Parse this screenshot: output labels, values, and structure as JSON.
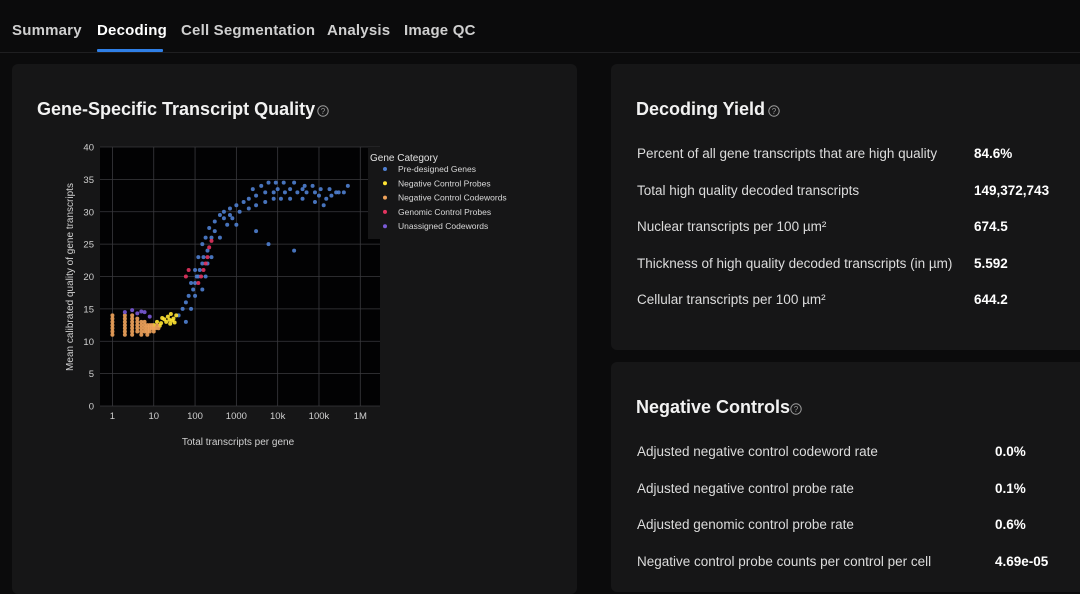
{
  "tabs": [
    {
      "label": "Summary",
      "active": false
    },
    {
      "label": "Decoding",
      "active": true
    },
    {
      "label": "Cell Segmentation",
      "active": false
    },
    {
      "label": "Analysis",
      "active": false
    },
    {
      "label": "Image QC",
      "active": false
    }
  ],
  "accent_color": "#2f7fe6",
  "help_icon": "question-circle-icon",
  "transcript_quality": {
    "title": "Gene-Specific Transcript Quality"
  },
  "decoding_yield": {
    "title": "Decoding Yield",
    "rows": [
      {
        "label": "Percent of all gene transcripts that are high quality",
        "value": "84.6%"
      },
      {
        "label": "Total high quality decoded transcripts",
        "value": "149,372,743"
      },
      {
        "label": "Nuclear transcripts per 100 µm²",
        "value": "674.5"
      },
      {
        "label": "Thickness of high quality decoded transcripts (in µm)",
        "value": "5.592"
      },
      {
        "label": "Cellular transcripts per 100 µm²",
        "value": "644.2"
      }
    ]
  },
  "negative_controls": {
    "title": "Negative Controls",
    "rows": [
      {
        "label": "Adjusted negative control codeword rate",
        "value": "0.0%"
      },
      {
        "label": "Adjusted negative control probe rate",
        "value": "0.1%"
      },
      {
        "label": "Adjusted genomic control probe rate",
        "value": "0.6%"
      },
      {
        "label": "Negative control probe counts per control per cell",
        "value": "4.69e-05"
      }
    ]
  },
  "chart_data": {
    "type": "scatter",
    "title": "",
    "xlabel": "Total transcripts per gene",
    "ylabel": "Mean calibrated quality of gene transcripts",
    "x_scale": "log",
    "xlim": [
      0.5,
      3000000
    ],
    "ylim": [
      0,
      40
    ],
    "x_ticks": [
      {
        "value": 1,
        "label": "1"
      },
      {
        "value": 10,
        "label": "10"
      },
      {
        "value": 100,
        "label": "100"
      },
      {
        "value": 1000,
        "label": "1000"
      },
      {
        "value": 10000,
        "label": "10k"
      },
      {
        "value": 100000,
        "label": "100k"
      },
      {
        "value": 1000000,
        "label": "1M"
      }
    ],
    "y_ticks": [
      0,
      5,
      10,
      15,
      20,
      25,
      30,
      35,
      40
    ],
    "grid": true,
    "legend_position": "top-right",
    "legend_title": "Gene Category",
    "series": [
      {
        "name": "Pre-designed Genes",
        "color": "#4f7fd0",
        "points": [
          [
            40,
            14
          ],
          [
            50,
            15
          ],
          [
            60,
            16
          ],
          [
            70,
            17
          ],
          [
            80,
            19
          ],
          [
            100,
            21
          ],
          [
            120,
            23
          ],
          [
            150,
            25
          ],
          [
            180,
            26
          ],
          [
            220,
            27.5
          ],
          [
            300,
            28.5
          ],
          [
            400,
            29.5
          ],
          [
            500,
            30
          ],
          [
            700,
            30.5
          ],
          [
            1000,
            31
          ],
          [
            1500,
            31.5
          ],
          [
            2000,
            32
          ],
          [
            3000,
            32.5
          ],
          [
            5000,
            33
          ],
          [
            8000,
            33
          ],
          [
            10000,
            33.5
          ],
          [
            15000,
            33
          ],
          [
            20000,
            33.5
          ],
          [
            30000,
            33
          ],
          [
            40000,
            33.5
          ],
          [
            50000,
            33
          ],
          [
            80000,
            33
          ],
          [
            100000,
            32.5
          ],
          [
            150000,
            32
          ],
          [
            200000,
            32.5
          ],
          [
            300000,
            33
          ],
          [
            500000,
            34
          ],
          [
            120,
            20
          ],
          [
            150,
            22
          ],
          [
            200,
            24
          ],
          [
            250,
            26
          ],
          [
            300,
            27
          ],
          [
            150,
            18
          ],
          [
            180,
            20
          ],
          [
            250,
            23
          ],
          [
            400,
            26
          ],
          [
            600,
            28
          ],
          [
            800,
            29
          ],
          [
            1200,
            30
          ],
          [
            2000,
            30.5
          ],
          [
            3000,
            31
          ],
          [
            5000,
            31.5
          ],
          [
            8000,
            32
          ],
          [
            12000,
            32
          ],
          [
            20000,
            32
          ],
          [
            40000,
            32
          ],
          [
            80000,
            31.5
          ],
          [
            130000,
            31
          ],
          [
            60,
            13
          ],
          [
            80,
            15
          ],
          [
            100,
            17
          ],
          [
            200,
            22
          ],
          [
            1000,
            28
          ],
          [
            3000,
            27
          ],
          [
            6000,
            25
          ],
          [
            25000,
            24
          ],
          [
            100,
            19
          ],
          [
            90,
            18
          ],
          [
            110,
            20
          ],
          [
            130,
            21
          ],
          [
            160,
            23
          ],
          [
            700,
            29.5
          ],
          [
            500,
            29
          ],
          [
            2500,
            33.5
          ],
          [
            4000,
            34
          ],
          [
            6000,
            34.5
          ],
          [
            9000,
            34.5
          ],
          [
            14000,
            34.5
          ],
          [
            25000,
            34.5
          ],
          [
            45000,
            34
          ],
          [
            70000,
            34
          ],
          [
            110000,
            33.5
          ],
          [
            180000,
            33.5
          ],
          [
            260000,
            33
          ],
          [
            400000,
            33
          ],
          [
            2000000,
            34
          ]
        ]
      },
      {
        "name": "Negative Control Probes",
        "color": "#ffe433",
        "points": [
          [
            10,
            12.5
          ],
          [
            12,
            13
          ],
          [
            15,
            12.8
          ],
          [
            18,
            13.4
          ],
          [
            20,
            13
          ],
          [
            22,
            13.8
          ],
          [
            25,
            12.7
          ],
          [
            28,
            13.2
          ],
          [
            30,
            13.5
          ],
          [
            32,
            12.9
          ],
          [
            35,
            14
          ],
          [
            16,
            13.6
          ],
          [
            24,
            13.3
          ],
          [
            26,
            14.2
          ],
          [
            14,
            12.4
          ]
        ]
      },
      {
        "name": "Negative Control Codewords",
        "color": "#f0a35b",
        "points": [
          [
            1,
            11
          ],
          [
            1,
            11.5
          ],
          [
            1,
            12
          ],
          [
            1,
            12.5
          ],
          [
            1,
            13
          ],
          [
            1,
            13.5
          ],
          [
            1,
            14
          ],
          [
            2,
            11
          ],
          [
            2,
            11.5
          ],
          [
            2,
            12
          ],
          [
            2,
            12.5
          ],
          [
            2,
            13
          ],
          [
            2,
            13.5
          ],
          [
            2,
            14
          ],
          [
            3,
            11
          ],
          [
            3,
            11.5
          ],
          [
            3,
            12
          ],
          [
            3,
            12.5
          ],
          [
            3,
            13
          ],
          [
            3,
            13.5
          ],
          [
            3,
            14
          ],
          [
            4,
            11.5
          ],
          [
            4,
            12
          ],
          [
            4,
            12.5
          ],
          [
            4,
            13
          ],
          [
            4,
            13.5
          ],
          [
            5,
            11
          ],
          [
            5,
            11.5
          ],
          [
            5,
            12
          ],
          [
            5,
            12.5
          ],
          [
            5,
            13
          ],
          [
            6,
            11.5
          ],
          [
            6,
            12
          ],
          [
            6,
            12.5
          ],
          [
            6,
            13
          ],
          [
            7,
            11
          ],
          [
            7,
            11.5
          ],
          [
            7,
            12
          ],
          [
            7,
            12.5
          ],
          [
            8,
            11.5
          ],
          [
            8,
            12
          ],
          [
            8,
            12.5
          ],
          [
            9,
            12
          ],
          [
            9,
            12.5
          ],
          [
            10,
            11.5
          ],
          [
            10,
            12
          ],
          [
            11,
            12
          ],
          [
            12,
            12.5
          ],
          [
            13,
            12
          ]
        ]
      },
      {
        "name": "Genomic Control Probes",
        "color": "#e3345f",
        "points": [
          [
            120,
            19
          ],
          [
            140,
            20
          ],
          [
            160,
            21
          ],
          [
            180,
            22
          ],
          [
            200,
            23
          ],
          [
            220,
            24.5
          ],
          [
            250,
            25.5
          ],
          [
            60,
            20
          ],
          [
            70,
            21
          ]
        ]
      },
      {
        "name": "Unassigned Codewords",
        "color": "#7a5ad6",
        "points": [
          [
            2,
            14.5
          ],
          [
            3,
            14.8
          ],
          [
            4,
            14.3
          ],
          [
            6,
            14.5
          ],
          [
            8,
            13.8
          ],
          [
            5,
            14.6
          ]
        ]
      }
    ]
  }
}
